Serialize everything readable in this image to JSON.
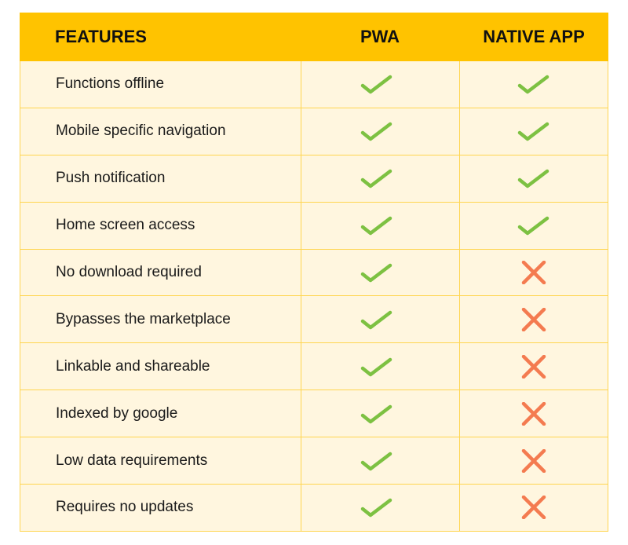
{
  "headers": {
    "features": "FEATURES",
    "pwa": "PWA",
    "native": "NATIVE APP"
  },
  "colors": {
    "header_bg": "#FFC300",
    "row_bg": "#FFF6DF",
    "border": "#FFD54F",
    "check": "#7DC142",
    "cross": "#F47B50"
  },
  "rows": [
    {
      "feature": "Functions offline",
      "pwa": "check-icon",
      "native": "check-icon"
    },
    {
      "feature": "Mobile specific navigation",
      "pwa": "check-icon",
      "native": "check-icon"
    },
    {
      "feature": "Push notification",
      "pwa": "check-icon",
      "native": "check-icon"
    },
    {
      "feature": "Home screen access",
      "pwa": "check-icon",
      "native": "check-icon"
    },
    {
      "feature": "No download required",
      "pwa": "check-icon",
      "native": "cross-icon"
    },
    {
      "feature": "Bypasses the marketplace",
      "pwa": "check-icon",
      "native": "cross-icon"
    },
    {
      "feature": "Linkable and shareable",
      "pwa": "check-icon",
      "native": "cross-icon"
    },
    {
      "feature": "Indexed by google",
      "pwa": "check-icon",
      "native": "cross-icon"
    },
    {
      "feature": "Low data requirements",
      "pwa": "check-icon",
      "native": "cross-icon"
    },
    {
      "feature": "Requires no updates",
      "pwa": "check-icon",
      "native": "cross-icon"
    }
  ]
}
